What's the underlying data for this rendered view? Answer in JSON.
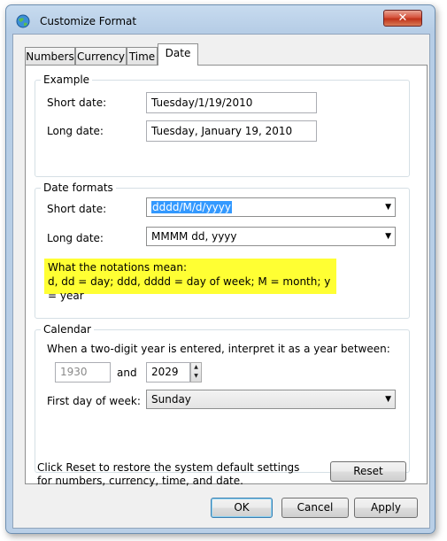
{
  "window": {
    "title": "Customize Format",
    "close_glyph": "✕"
  },
  "tabs": [
    {
      "label": "Numbers"
    },
    {
      "label": "Currency"
    },
    {
      "label": "Time"
    },
    {
      "label": "Date"
    }
  ],
  "example": {
    "legend": "Example",
    "short_label": "Short date:",
    "short_value": "Tuesday/1/19/2010",
    "long_label": "Long date:",
    "long_value": "Tuesday, January 19, 2010"
  },
  "formats": {
    "legend": "Date formats",
    "short_label": "Short date:",
    "short_value": "dddd/M/d/yyyy",
    "long_label": "Long date:",
    "long_value": "MMMM dd, yyyy",
    "hint_line1": "What the notations mean:",
    "hint_line2": "d, dd = day;  ddd, dddd = day of week;  M = month;  y = year"
  },
  "calendar": {
    "legend": "Calendar",
    "two_digit_label": "When a two-digit year is entered, interpret it as a year between:",
    "year_start": "1930",
    "and_label": "and",
    "year_end": "2029",
    "first_day_label": "First day of week:",
    "first_day_value": "Sunday"
  },
  "reset": {
    "text": "Click Reset to restore the system default settings for numbers, currency, time, and date.",
    "button": "Reset"
  },
  "buttons": {
    "ok": "OK",
    "cancel": "Cancel",
    "apply": "Apply"
  },
  "icons": {
    "title": "globe-icon",
    "combo_arrow": "▼",
    "spin_up": "▲",
    "spin_down": "▼"
  }
}
